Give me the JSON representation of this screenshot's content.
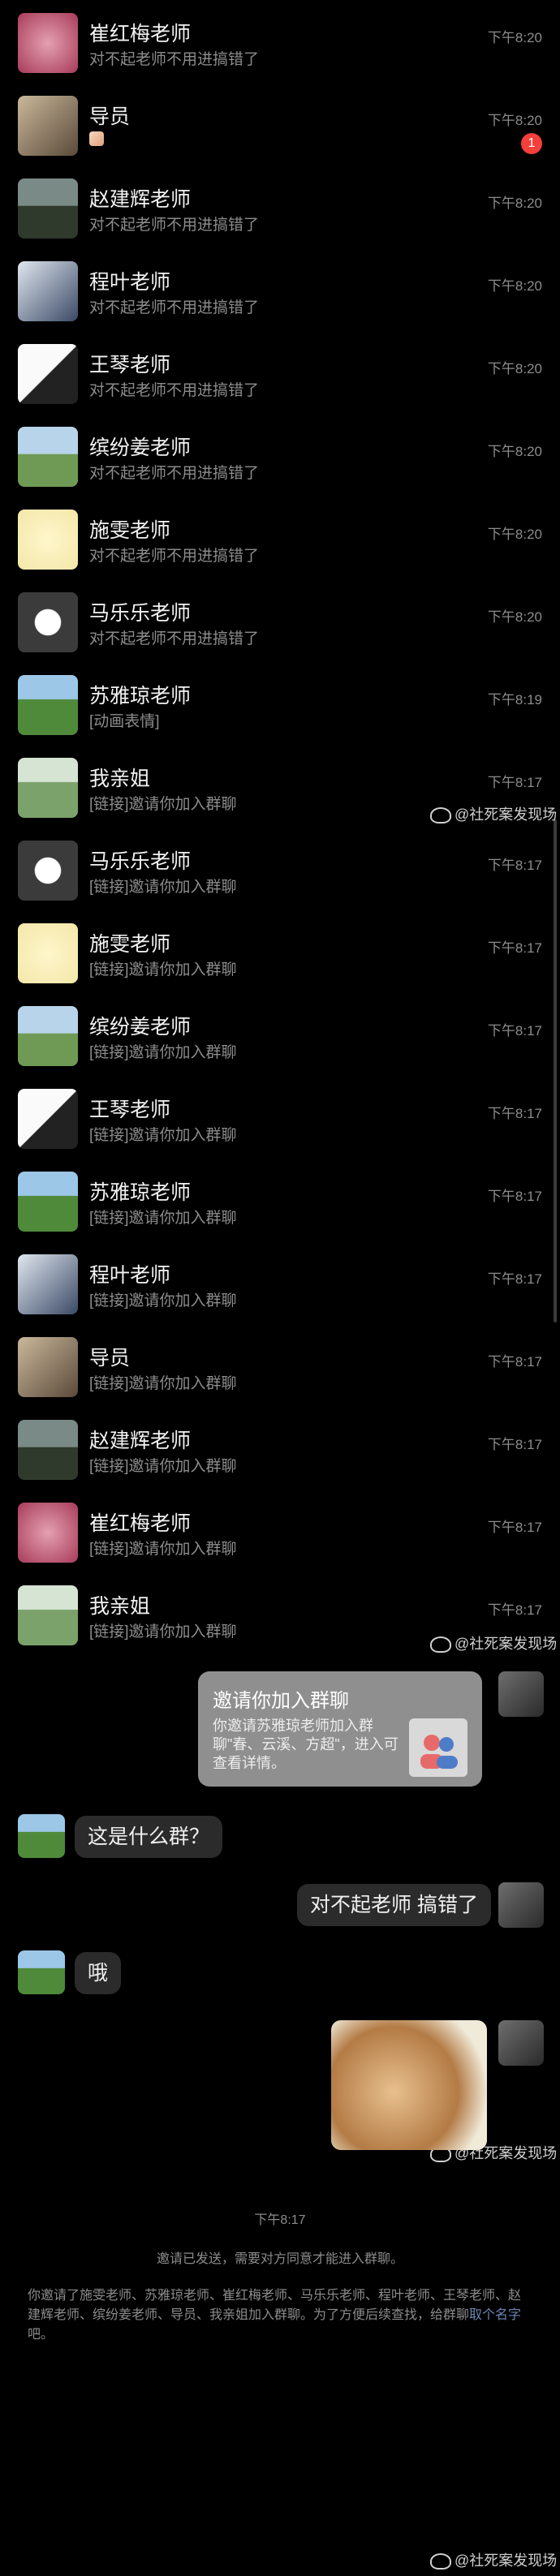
{
  "chats": [
    {
      "name": "崔红梅老师",
      "preview": "对不起老师不用进搞错了",
      "time": "下午8:20"
    },
    {
      "name": "导员",
      "preview": "",
      "time": "下午8:20",
      "badge": "1",
      "preview_emoji": true
    },
    {
      "name": "赵建辉老师",
      "preview": "对不起老师不用进搞错了",
      "time": "下午8:20"
    },
    {
      "name": "程叶老师",
      "preview": "对不起老师不用进搞错了",
      "time": "下午8:20"
    },
    {
      "name": "王琴老师",
      "preview": "对不起老师不用进搞错了",
      "time": "下午8:20"
    },
    {
      "name": "缤纷姜老师",
      "preview": "对不起老师不用进搞错了",
      "time": "下午8:20"
    },
    {
      "name": "施雯老师",
      "preview": "对不起老师不用进搞错了",
      "time": "下午8:20"
    },
    {
      "name": "马乐乐老师",
      "preview": "对不起老师不用进搞错了",
      "time": "下午8:20"
    },
    {
      "name": "苏雅琼老师",
      "preview": "[动画表情]",
      "time": "下午8:19"
    },
    {
      "name": "我亲姐",
      "preview": "[链接]邀请你加入群聊",
      "time": "下午8:17"
    },
    {
      "name": "马乐乐老师",
      "preview": "[链接]邀请你加入群聊",
      "time": "下午8:17"
    },
    {
      "name": "施雯老师",
      "preview": "[链接]邀请你加入群聊",
      "time": "下午8:17"
    },
    {
      "name": "缤纷姜老师",
      "preview": "[链接]邀请你加入群聊",
      "time": "下午8:17"
    },
    {
      "name": "王琴老师",
      "preview": "[链接]邀请你加入群聊",
      "time": "下午8:17"
    },
    {
      "name": "苏雅琼老师",
      "preview": "[链接]邀请你加入群聊",
      "time": "下午8:17"
    },
    {
      "name": "程叶老师",
      "preview": "[链接]邀请你加入群聊",
      "time": "下午8:17"
    },
    {
      "name": "导员",
      "preview": "[链接]邀请你加入群聊",
      "time": "下午8:17"
    },
    {
      "name": "赵建辉老师",
      "preview": "[链接]邀请你加入群聊",
      "time": "下午8:17"
    },
    {
      "name": "崔红梅老师",
      "preview": "[链接]邀请你加入群聊",
      "time": "下午8:17"
    },
    {
      "name": "我亲姐",
      "preview": "[链接]邀请你加入群聊",
      "time": "下午8:17"
    }
  ],
  "watermark": "@社死案发现场",
  "conversation": {
    "invite_title": "邀请你加入群聊",
    "invite_desc": "你邀请苏雅琼老师加入群聊\"春、云溪、方超\"，进入可查看详情。",
    "msg_question": "这是什么群？",
    "msg_sorry": "对不起老师 搞错了",
    "msg_oh": "哦"
  },
  "system": {
    "time": "下午8:17",
    "sent_note": "邀请已发送，需要对方同意才能进入群聊。",
    "invite_note": "你邀请了施雯老师、苏雅琼老师、崔红梅老师、马乐乐老师、程叶老师、王琴老师、赵建辉老师、缤纷姜老师、导员、我亲姐加入群聊。为了方便后续查找，给群聊",
    "invite_link": "取个名字",
    "invite_tail": "吧。"
  },
  "colors": {
    "background": "#000000",
    "badge": "#f43f3b",
    "link": "#6d86b5"
  }
}
